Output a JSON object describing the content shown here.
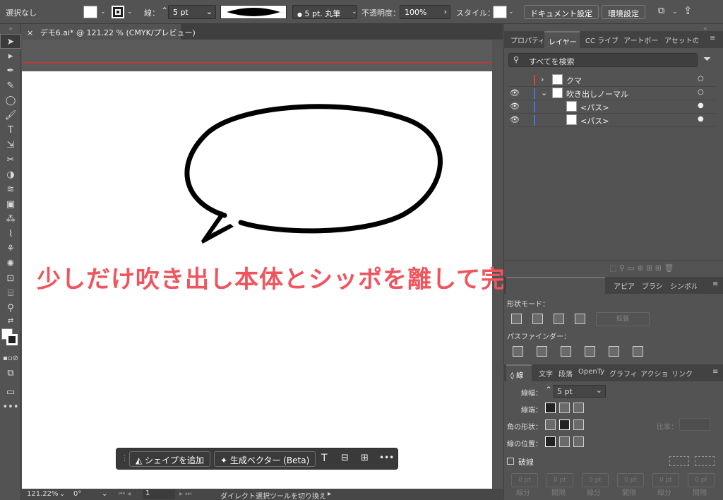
{
  "control_bar": {
    "selection": "選択なし",
    "stroke_label": "線：",
    "stroke_weight": "5 pt",
    "brush": "5 pt. 丸筆",
    "opacity_label": "不透明度：",
    "opacity_value": "100%",
    "style_label": "スタイル：",
    "doc_setup": "ドキュメント設定",
    "preferences": "環境設定"
  },
  "document": {
    "tab_title": "デモ6.ai* @ 121.22 % (CMYK/プレビュー)",
    "caption": "少しだけ吹き出し本体とシッポを離して完成！"
  },
  "taskbar": {
    "add_shape": "シェイプを追加",
    "generate_vector": "生成ベクター (Beta)"
  },
  "status": {
    "zoom": "121.22%",
    "rotation": "0°",
    "artboard": "1",
    "hint": "ダイレクト選択ツールを切り換え"
  },
  "panel_top": {
    "tabs": [
      "プロパティ",
      "レイヤー",
      "CC ライブ",
      "アートボー",
      "アセットの"
    ],
    "search_placeholder": "すべてを検索",
    "layers": [
      {
        "name": "クマ",
        "expand": "›",
        "color": "#e0403a",
        "visible": false,
        "indent": 0
      },
      {
        "name": "吹き出しノーマル",
        "expand": "⌄",
        "color": "#4a6fe0",
        "visible": true,
        "indent": 0
      },
      {
        "name": "<パス>",
        "expand": "",
        "color": "#4a6fe0",
        "visible": true,
        "indent": 1
      },
      {
        "name": "<パス>",
        "expand": "",
        "color": "#4a6fe0",
        "visible": true,
        "indent": 1
      }
    ]
  },
  "panel_pathfinder": {
    "tabs": [
      "アピア",
      "ブラシ",
      "シンボル"
    ],
    "shape_modes": "形状モード：",
    "expand_button": "拡張",
    "pathfinders": "パスファインダー："
  },
  "panel_stroke": {
    "tabs": [
      "線",
      "文字",
      "段落",
      "OpenTy",
      "グラフィ",
      "アクショ",
      "リンク"
    ],
    "weight_label": "線幅：",
    "weight_value": "5 pt",
    "cap_label": "線端：",
    "corner_label": "角の形状：",
    "limit_label": "比率：",
    "align_label": "線の位置：",
    "dashed_label": "破線",
    "dash_items": [
      "線分",
      "間隔",
      "線分",
      "間隔",
      "線分",
      "間隔"
    ],
    "dash_values": [
      "0 pt",
      "0 pt",
      "0 pt",
      "0 pt",
      "0 pt",
      "0 pt"
    ]
  },
  "colors": {
    "caption": "#f0555e",
    "guide_red": "#d9302b",
    "ui_bg": "#535353"
  }
}
